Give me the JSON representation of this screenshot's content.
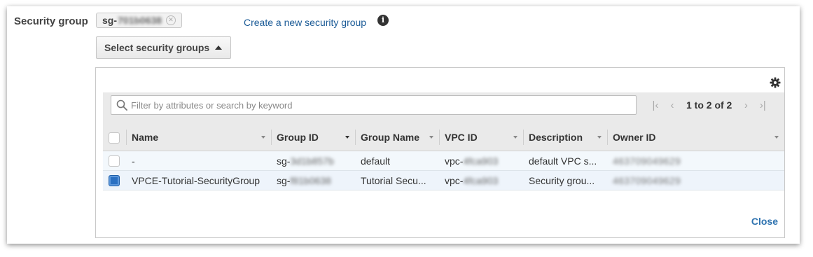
{
  "form": {
    "label": "Security group",
    "token_prefix": "sg-",
    "token_hidden": "701b0638",
    "create_link": "Create a new security group",
    "select_button": "Select security groups"
  },
  "search": {
    "placeholder": "Filter by attributes or search by keyword",
    "value": ""
  },
  "pager": {
    "range": "1 to 2 of 2"
  },
  "table": {
    "columns": [
      "Name",
      "Group ID",
      "Group Name",
      "VPC ID",
      "Description",
      "Owner ID"
    ],
    "rows": [
      {
        "selected": false,
        "name": "-",
        "group_id_prefix": "sg-",
        "group_id_hidden": "3d1b857b",
        "group_name": "default",
        "vpc_prefix": "vpc-",
        "vpc_hidden": "4fca903",
        "description": "default VPC s...",
        "owner_hidden": "463709049629"
      },
      {
        "selected": true,
        "name": "VPCE-Tutorial-SecurityGroup",
        "group_id_prefix": "sg-",
        "group_id_hidden": "f81b0638",
        "group_name": "Tutorial Secu...",
        "vpc_prefix": "vpc-",
        "vpc_hidden": "4fca903",
        "description": "Security grou...",
        "owner_hidden": "463709049629"
      }
    ]
  },
  "close_label": "Close",
  "icons": {
    "info": "info-icon",
    "gear": "gear-icon",
    "search": "search-icon",
    "remove": "remove-token-icon"
  },
  "colors": {
    "link": "#1a5a96",
    "checkbox_checked": "#2a70c2",
    "header_bg": "#eaeaea"
  }
}
